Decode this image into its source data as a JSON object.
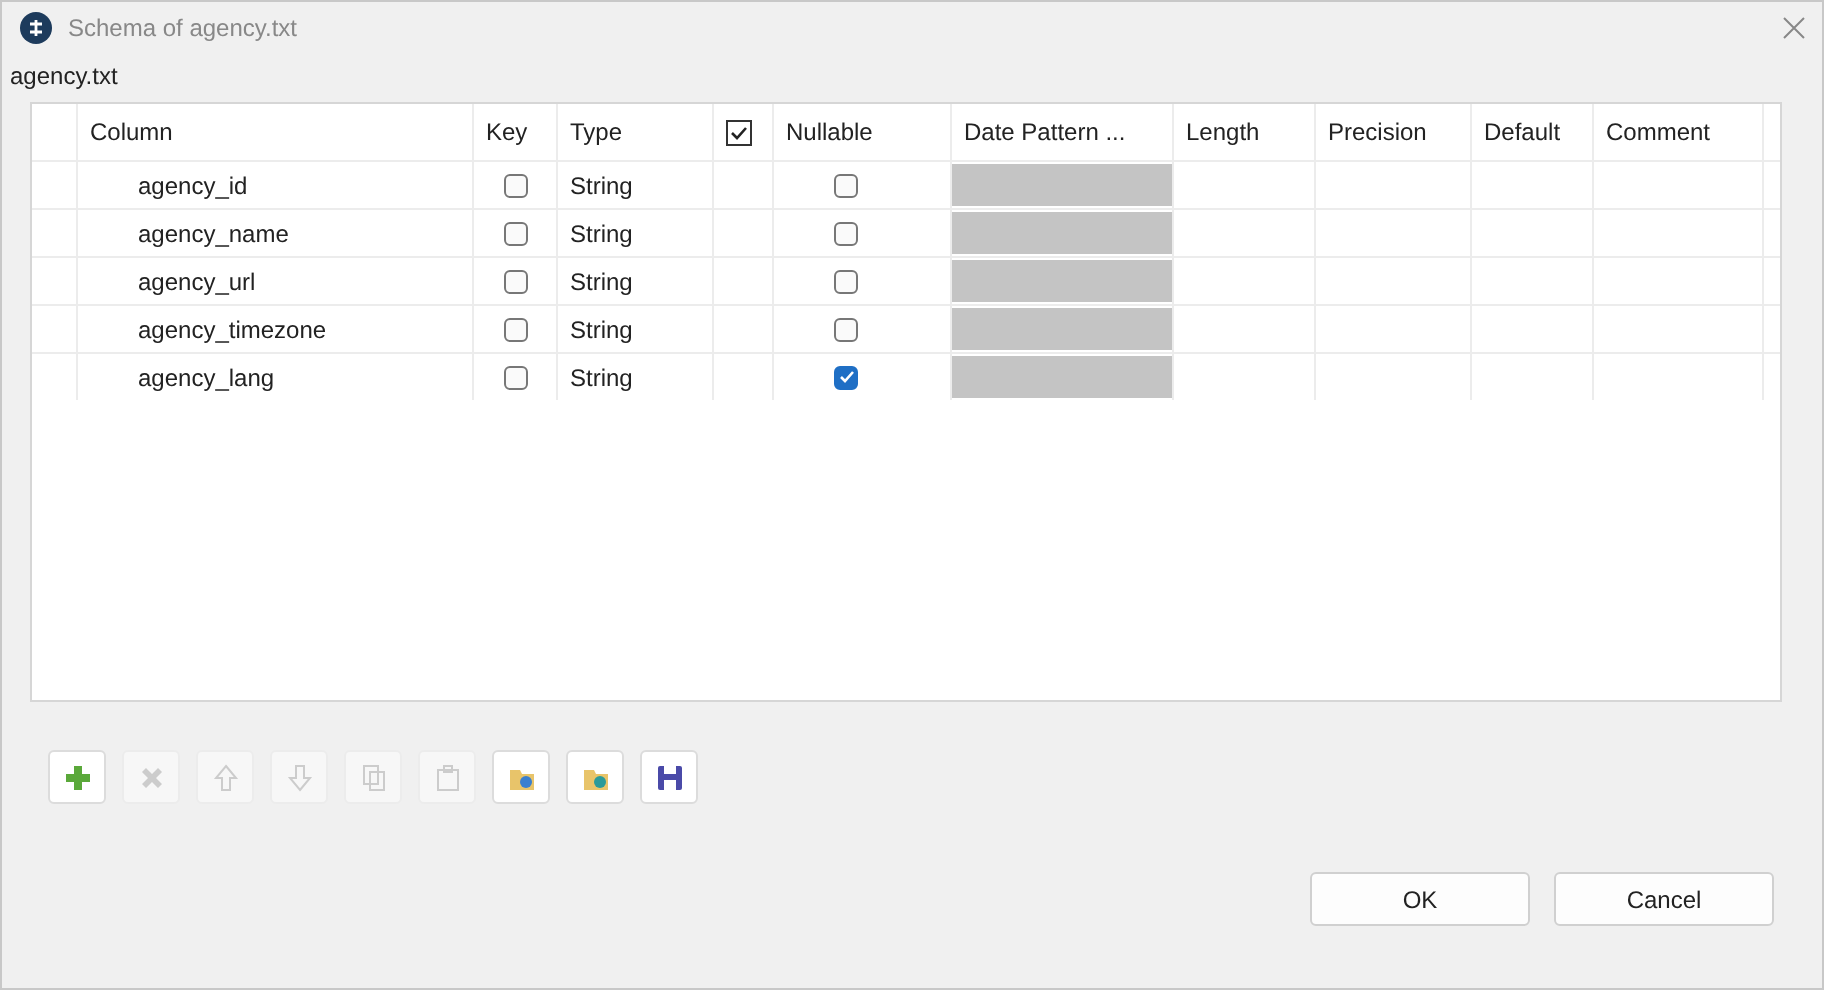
{
  "window": {
    "title": "Schema of agency.txt"
  },
  "schema_label": "agency.txt",
  "table": {
    "columns": [
      {
        "label": "Column",
        "kind": "text"
      },
      {
        "label": "Key",
        "kind": "text"
      },
      {
        "label": "Type",
        "kind": "text"
      },
      {
        "kind": "check",
        "checked": true
      },
      {
        "label": "Nullable",
        "kind": "text"
      },
      {
        "label": "Date Pattern ...",
        "kind": "text"
      },
      {
        "label": "Length",
        "kind": "text"
      },
      {
        "label": "Precision",
        "kind": "text"
      },
      {
        "label": "Default",
        "kind": "text"
      },
      {
        "label": "Comment",
        "kind": "text"
      }
    ],
    "rows": [
      {
        "column": "agency_id",
        "key": false,
        "type": "String",
        "nullable": false
      },
      {
        "column": "agency_name",
        "key": false,
        "type": "String",
        "nullable": false
      },
      {
        "column": "agency_url",
        "key": false,
        "type": "String",
        "nullable": false
      },
      {
        "column": "agency_timezone",
        "key": false,
        "type": "String",
        "nullable": false
      },
      {
        "column": "agency_lang",
        "key": false,
        "type": "String",
        "nullable": true
      }
    ]
  },
  "toolbar": [
    {
      "kind": "add",
      "disabled": false
    },
    {
      "kind": "remove",
      "disabled": true
    },
    {
      "kind": "up",
      "disabled": true
    },
    {
      "kind": "down",
      "disabled": true
    },
    {
      "kind": "copy",
      "disabled": true
    },
    {
      "kind": "paste",
      "disabled": true
    },
    {
      "kind": "import",
      "disabled": false
    },
    {
      "kind": "export",
      "disabled": false
    },
    {
      "kind": "save",
      "disabled": false
    }
  ],
  "buttons": [
    "OK",
    "Cancel"
  ]
}
